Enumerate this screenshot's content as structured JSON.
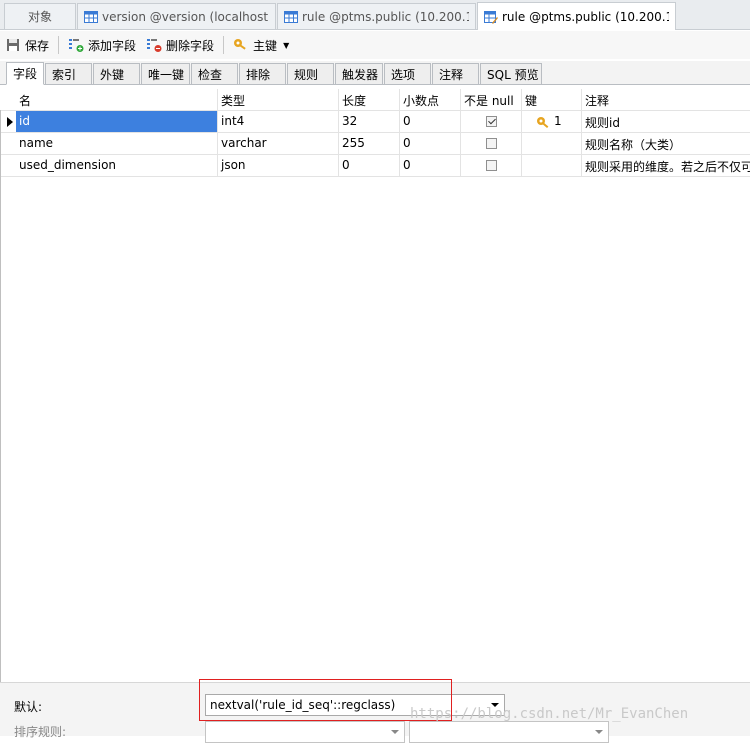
{
  "doc_tabs": [
    {
      "label": "对象",
      "icon": "none"
    },
    {
      "label": "version @version (localhost...",
      "icon": "table-icon"
    },
    {
      "label": "rule @ptms.public (10.200.1...",
      "icon": "table-icon"
    },
    {
      "label": "rule @ptms.public (10.200.1...",
      "icon": "table-design-icon"
    }
  ],
  "toolbar": {
    "save": "保存",
    "add_field": "添加字段",
    "delete_field": "删除字段",
    "primary_key": "主键"
  },
  "sub_tabs": [
    "字段",
    "索引",
    "外键",
    "唯一键",
    "检查",
    "排除",
    "规则",
    "触发器",
    "选项",
    "注释",
    "SQL 预览"
  ],
  "columns": {
    "name": "名",
    "type": "类型",
    "length": "长度",
    "decimals": "小数点",
    "not_null": "不是 null",
    "key": "键",
    "comment": "注释"
  },
  "rows": [
    {
      "name": "id",
      "type": "int4",
      "length": "32",
      "decimals": "0",
      "not_null": true,
      "key": "1",
      "comment": "规则id"
    },
    {
      "name": "name",
      "type": "varchar",
      "length": "255",
      "decimals": "0",
      "not_null": false,
      "key": "",
      "comment": "规则名称（大类）"
    },
    {
      "name": "used_dimension",
      "type": "json",
      "length": "0",
      "decimals": "0",
      "not_null": false,
      "key": "",
      "comment": "规则采用的维度。若之后不仅可"
    }
  ],
  "props": {
    "default_label": "默认:",
    "default_value": "nextval('rule_id_seq'::regclass)",
    "sort_label": "排序规则:"
  },
  "watermark": "https://blog.csdn.net/Mr_EvanChen",
  "colors": {
    "selection": "#3d80df",
    "highlight_box": "#e02020"
  }
}
